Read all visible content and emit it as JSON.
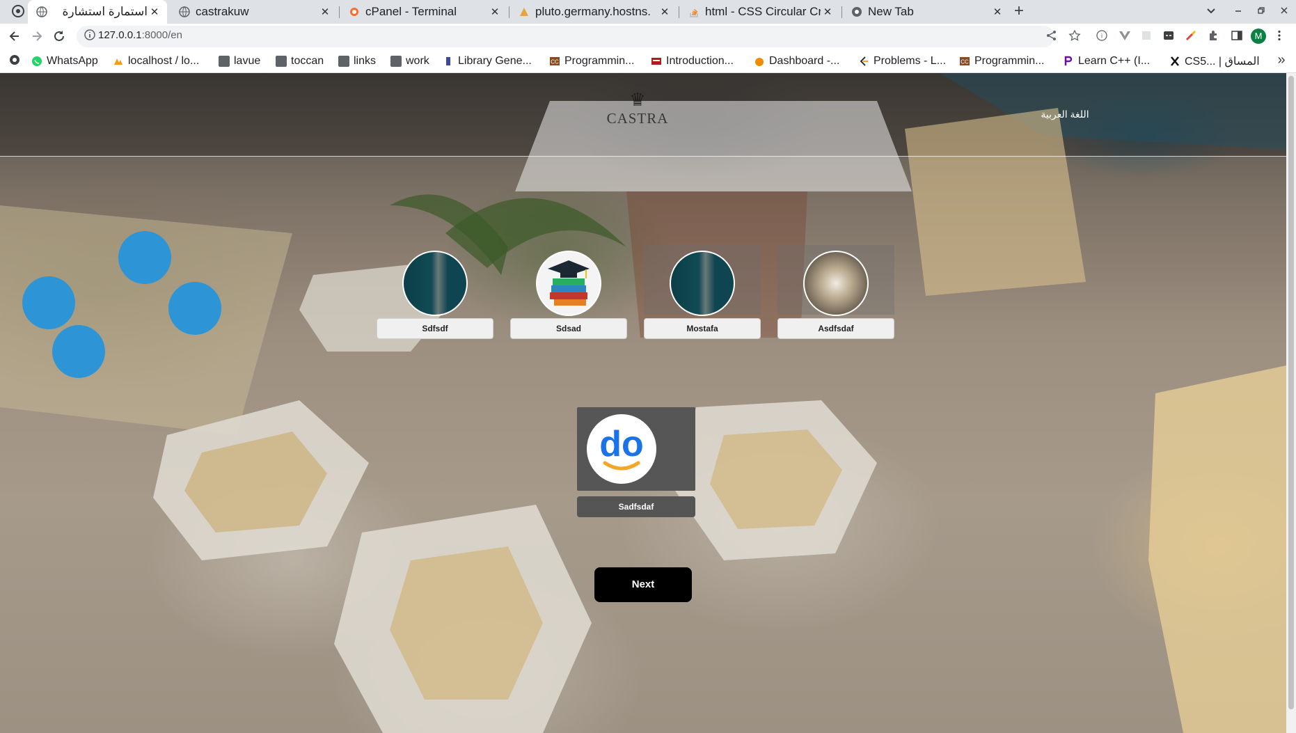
{
  "browser": {
    "tabs": [
      {
        "title": "استمارة استشارة",
        "active": true,
        "icon": "globe-icon"
      },
      {
        "title": "castrakuw",
        "icon": "globe-icon"
      },
      {
        "title": "cPanel - Terminal",
        "icon": "cpanel-icon"
      },
      {
        "title": "pluto.germany.hostns.",
        "icon": "server-icon"
      },
      {
        "title": "html - CSS Circular Cro",
        "icon": "stackoverflow-icon"
      },
      {
        "title": "New Tab",
        "icon": "chrome-icon"
      }
    ],
    "new_tab_symbol": "+",
    "close_symbol": "✕",
    "url_host": "127.0.0.1",
    "url_path": ":8000/en",
    "profile_initial": "M",
    "bookmarks": [
      {
        "label": "WhatsApp",
        "icon": "whatsapp-icon",
        "color": "#25d366"
      },
      {
        "label": "localhost / lo...",
        "icon": "phpmyadmin-icon",
        "color": "#f39c12"
      },
      {
        "label": "lavue",
        "icon": "folder-icon"
      },
      {
        "label": "toccan",
        "icon": "folder-icon"
      },
      {
        "label": "links",
        "icon": "folder-icon"
      },
      {
        "label": "work",
        "icon": "folder-icon"
      },
      {
        "label": "Library Gene...",
        "icon": "library-icon",
        "color": "#3b4a9c"
      },
      {
        "label": "Programmin...",
        "icon": "cc-icon",
        "color": "#8a4a20"
      },
      {
        "label": "Introduction...",
        "icon": "book-icon",
        "color": "#b01c1c"
      },
      {
        "label": "Dashboard -...",
        "icon": "dashboard-icon",
        "color": "#f08c00"
      },
      {
        "label": "Problems - L...",
        "icon": "leetcode-icon",
        "color": "#333"
      },
      {
        "label": "Programmin...",
        "icon": "cc-icon",
        "color": "#8a4a20"
      },
      {
        "label": "Learn C++ (I...",
        "icon": "learncpp-icon",
        "color": "#6a0dad"
      },
      {
        "label": "CS5... | المساق",
        "icon": "x-icon",
        "color": "#111"
      }
    ],
    "more_bookmarks": "»"
  },
  "page": {
    "logo_text": "CASTRA",
    "language_link": "اللغة العربية",
    "options": [
      {
        "name": "Sdfsdf",
        "image": "dark-teal-photo",
        "highlighted": false
      },
      {
        "name": "Sdsad",
        "image": "books-graduation-cap",
        "highlighted": false
      },
      {
        "name": "Mostafa",
        "image": "dark-teal-photo",
        "highlighted": true
      },
      {
        "name": "Asdfsdaf",
        "image": "venue-photo",
        "highlighted": true
      }
    ],
    "selected_option": {
      "name": "Sadfsdaf",
      "image": "do-logo",
      "logo_text": "do"
    },
    "next_button": "Next",
    "colors": {
      "selected_card": "#565656",
      "next_button": "#000000",
      "logo_blue": "#1a73e8",
      "logo_orange": "#f5a623"
    }
  }
}
